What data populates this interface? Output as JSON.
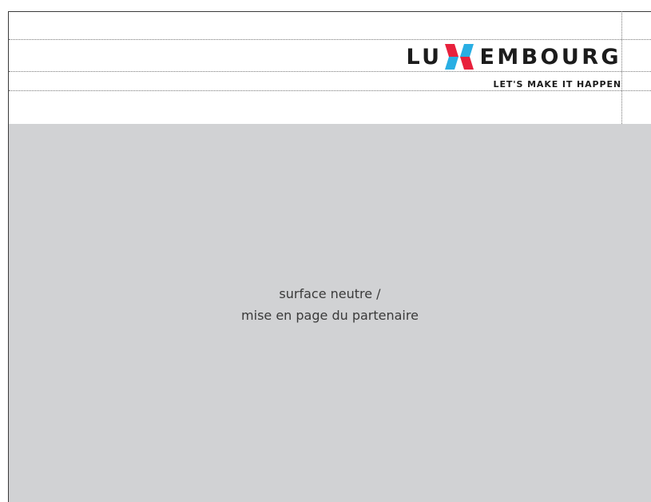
{
  "logo": {
    "left_text": "LU",
    "right_text": "EMBOURG",
    "mark_icon": "luxembourg-x-mark-icon",
    "tagline": "LET'S MAKE IT HAPPEN"
  },
  "surface": {
    "line1": "surface neutre /",
    "line2": "mise en page du partenaire"
  },
  "colors": {
    "text_dark": "#1c1c1c",
    "mark_red": "#e8213c",
    "mark_blue": "#29aee3",
    "surface_gray": "#d1d2d4"
  }
}
